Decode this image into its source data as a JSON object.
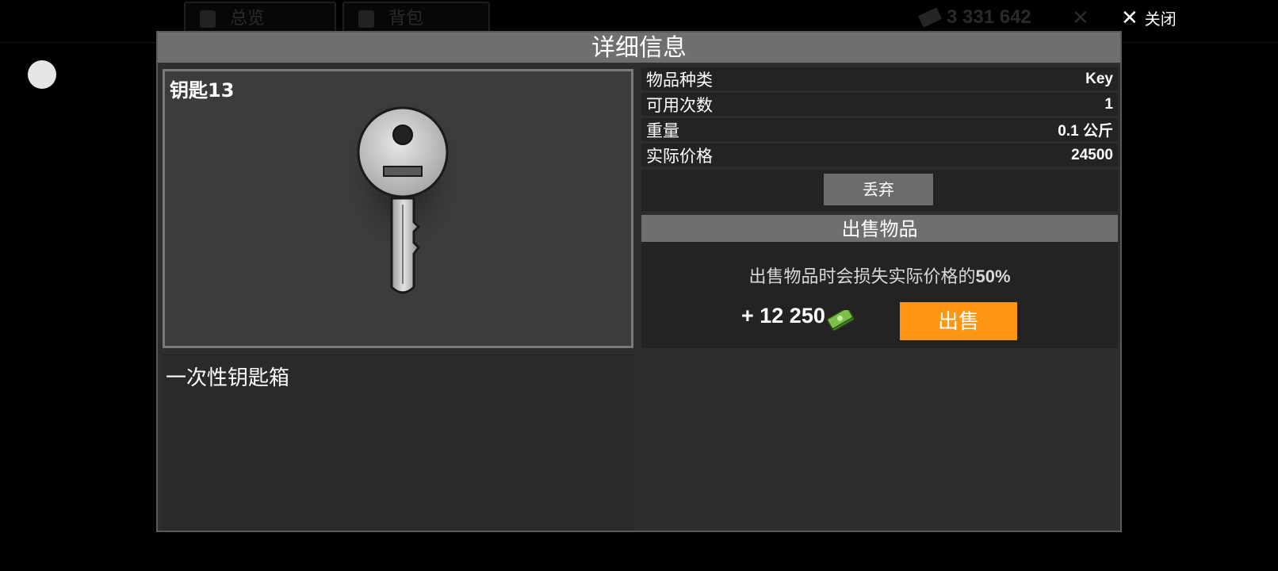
{
  "background": {
    "tabs": [
      "总览",
      "背包"
    ],
    "money": "3 331 642"
  },
  "close": {
    "icon": "close-icon",
    "label": "关闭"
  },
  "modal": {
    "title": "详细信息",
    "item": {
      "name": "钥匙13",
      "image_icon": "key-icon",
      "description": "一次性钥匙箱"
    },
    "stats": [
      {
        "label": "物品种类",
        "value": "Key"
      },
      {
        "label": "可用次数",
        "value": "1"
      },
      {
        "label": "重量",
        "value": "0.1 公斤"
      },
      {
        "label": "实际价格",
        "value": "24500"
      }
    ],
    "discard_label": "丢弃",
    "sell": {
      "header": "出售物品",
      "note_prefix": "出售物品时会损失实际价格的",
      "note_percent": "50%",
      "amount": "+ 12 250",
      "currency_icon": "cash-icon",
      "button_label": "出售"
    }
  },
  "colors": {
    "accent": "#ff9612",
    "header_bg": "#6f6f6f",
    "panel_bg": "#2d2d2d"
  }
}
